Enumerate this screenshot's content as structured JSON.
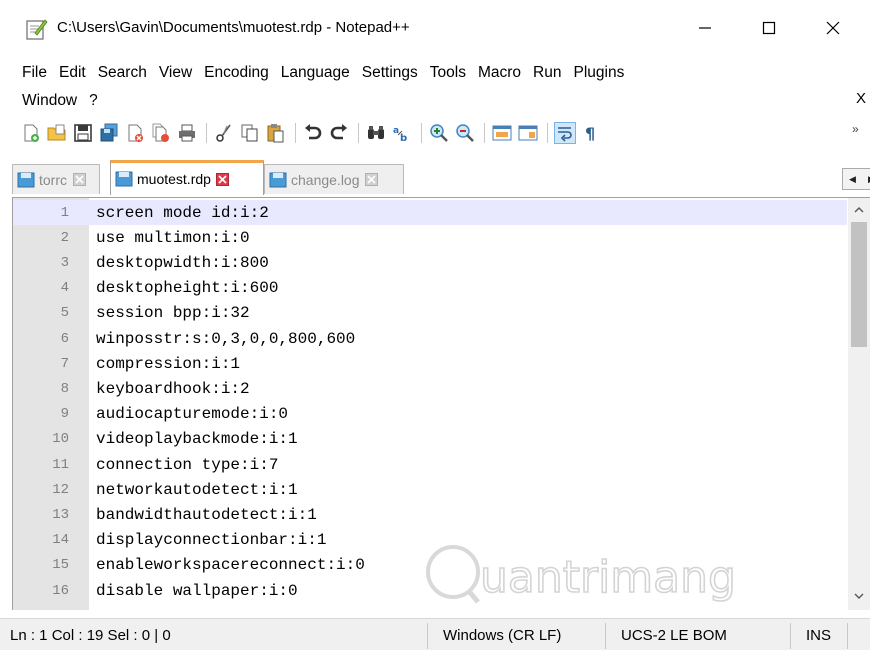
{
  "window": {
    "title": "C:\\Users\\Gavin\\Documents\\muotest.rdp - Notepad++"
  },
  "menu": {
    "row1": [
      "File",
      "Edit",
      "Search",
      "View",
      "Encoding",
      "Language",
      "Settings",
      "Tools",
      "Macro",
      "Run",
      "Plugins"
    ],
    "row2": [
      "Window",
      "?"
    ],
    "close_doc": "X"
  },
  "toolbar": {
    "more": "»"
  },
  "tabs": [
    {
      "label": "torrc",
      "active": false
    },
    {
      "label": "muotest.rdp",
      "active": true
    },
    {
      "label": "change.log",
      "active": false
    }
  ],
  "editor": {
    "current_line": 1,
    "lines": [
      {
        "num": "1",
        "text": "screen mode id:i:2"
      },
      {
        "num": "2",
        "text": "use multimon:i:0"
      },
      {
        "num": "3",
        "text": "desktopwidth:i:800"
      },
      {
        "num": "4",
        "text": "desktopheight:i:600"
      },
      {
        "num": "5",
        "text": "session bpp:i:32"
      },
      {
        "num": "6",
        "text": "winposstr:s:0,3,0,0,800,600"
      },
      {
        "num": "7",
        "text": "compression:i:1"
      },
      {
        "num": "8",
        "text": "keyboardhook:i:2"
      },
      {
        "num": "9",
        "text": "audiocapturemode:i:0"
      },
      {
        "num": "10",
        "text": "videoplaybackmode:i:1"
      },
      {
        "num": "11",
        "text": "connection type:i:7"
      },
      {
        "num": "12",
        "text": "networkautodetect:i:1"
      },
      {
        "num": "13",
        "text": "bandwidthautodetect:i:1"
      },
      {
        "num": "14",
        "text": "displayconnectionbar:i:1"
      },
      {
        "num": "15",
        "text": "enableworkspacereconnect:i:0"
      },
      {
        "num": "16",
        "text": "disable wallpaper:i:0"
      }
    ]
  },
  "status": {
    "position": "Ln : 1    Col : 19    Sel : 0 | 0",
    "eol": "Windows (CR LF)",
    "encoding": "UCS-2 LE BOM",
    "mode": "INS"
  },
  "watermark": "uantrimang",
  "colors": {
    "active_tab_accent": "#f3a54a",
    "current_line": "#e8e8ff",
    "gutter": "#e4e4e4"
  }
}
